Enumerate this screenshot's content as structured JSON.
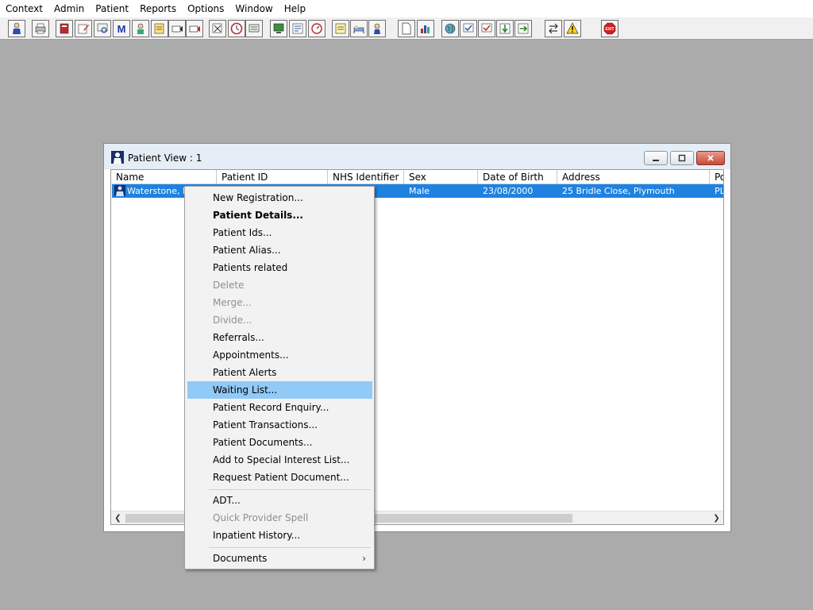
{
  "menubar": [
    "Context",
    "Admin",
    "Patient",
    "Reports",
    "Options",
    "Window",
    "Help"
  ],
  "toolbar": {
    "icons": [
      "person-icon",
      "printer-icon",
      "book-icon",
      "edit-icon",
      "search-icon",
      "m-icon",
      "doctor-icon",
      "notes-icon",
      "camera-icon",
      "camera2-icon",
      "magnify-icon",
      "clock-icon",
      "screen-icon",
      "monitor-icon",
      "form-icon",
      "dial-icon",
      "notepad-icon",
      "bed-icon",
      "nurse-icon",
      "document-icon",
      "chart-icon",
      "globe-icon",
      "check-icon",
      "check2-icon",
      "arrow-down-icon",
      "arrows-icon",
      "swap-icon",
      "warning-icon",
      "exit-icon"
    ],
    "exit_label": "EXIT"
  },
  "window": {
    "title": "Patient View : 1",
    "columns": [
      "Name",
      "Patient ID",
      "NHS Identifier",
      "Sex",
      "Date of Birth",
      "Address",
      "Po"
    ],
    "row": {
      "name": "Waterstone, Da",
      "patient_id": "",
      "nhs_identifier": "",
      "sex": "Male",
      "dob": "23/08/2000",
      "address": "25 Bridle Close, Plymouth",
      "postcode": "PL"
    }
  },
  "context_menu": {
    "items": [
      {
        "label": "New Registration...",
        "bold": false,
        "disabled": false
      },
      {
        "label": "Patient Details...",
        "bold": true,
        "disabled": false
      },
      {
        "label": "Patient Ids...",
        "bold": false,
        "disabled": false
      },
      {
        "label": "Patient Alias...",
        "bold": false,
        "disabled": false
      },
      {
        "label": "Patients related",
        "bold": false,
        "disabled": false
      },
      {
        "label": "Delete",
        "bold": false,
        "disabled": true
      },
      {
        "label": "Merge...",
        "bold": false,
        "disabled": true
      },
      {
        "label": "Divide...",
        "bold": false,
        "disabled": true
      },
      {
        "label": "Referrals...",
        "bold": false,
        "disabled": false
      },
      {
        "label": "Appointments...",
        "bold": false,
        "disabled": false
      },
      {
        "label": "Patient Alerts",
        "bold": false,
        "disabled": false
      },
      {
        "label": "Waiting List...",
        "bold": false,
        "disabled": false,
        "highlighted": true
      },
      {
        "label": "Patient Record Enquiry...",
        "bold": false,
        "disabled": false
      },
      {
        "label": "Patient Transactions...",
        "bold": false,
        "disabled": false
      },
      {
        "label": "Patient Documents...",
        "bold": false,
        "disabled": false
      },
      {
        "label": "Add to Special Interest List...",
        "bold": false,
        "disabled": false
      },
      {
        "label": "Request Patient Document...",
        "bold": false,
        "disabled": false
      },
      {
        "label": "ADT...",
        "bold": false,
        "disabled": false
      },
      {
        "label": "Quick Provider Spell",
        "bold": false,
        "disabled": true
      },
      {
        "label": "Inpatient History...",
        "bold": false,
        "disabled": false
      },
      {
        "label": "Documents",
        "bold": false,
        "disabled": false,
        "submenu": true
      }
    ],
    "submenu_arrow": "›"
  },
  "colors": {
    "selection": "#1f82e0",
    "menu_highlight": "#91c9f7",
    "desktop": "#ababab"
  }
}
